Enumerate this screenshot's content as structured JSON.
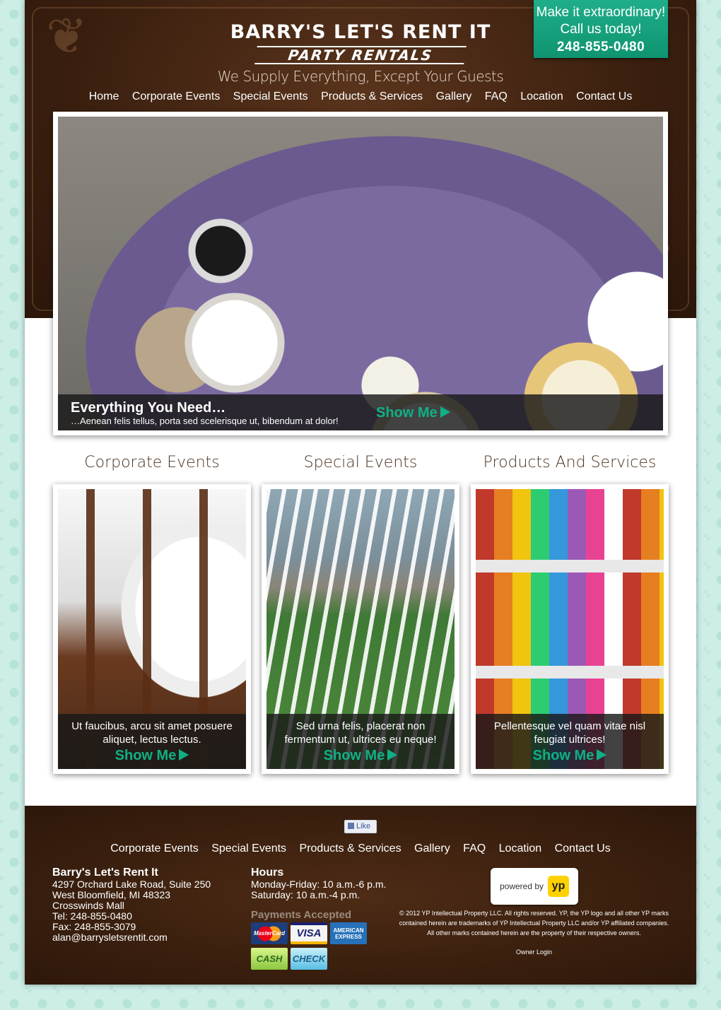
{
  "header": {
    "logo_line1": "BARRY'S LET'S RENT IT",
    "logo_line2": "PARTY RENTALS",
    "tagline": "We Supply Everything, Except Your Guests",
    "callout": {
      "line1": "Make it extraordinary!",
      "line2": "Call us today!",
      "phone": "248-855-0480"
    },
    "nav": [
      "Home",
      "Corporate Events",
      "Special Events",
      "Products & Services",
      "Gallery",
      "FAQ",
      "Location",
      "Contact Us"
    ]
  },
  "hero": {
    "title": "Everything You Need…",
    "subtitle": "…Aenean felis tellus, porta sed scelerisque ut, bibendum at dolor!",
    "button": "Show Me"
  },
  "sections": [
    {
      "title": "Corporate Events",
      "text": "Ut faucibus, arcu sit amet posuere aliquet, lectus lectus.",
      "button": "Show Me"
    },
    {
      "title": "Special Events",
      "text": "Sed urna felis, placerat non fermentum ut, ultrices eu neque!",
      "button": "Show Me"
    },
    {
      "title": "Products And Services",
      "text": "Pellentesque vel quam vitae nisl feugiat ultrices!",
      "button": "Show Me"
    }
  ],
  "footer": {
    "like": "Like",
    "nav": [
      "Corporate Events",
      "Special Events",
      "Products & Services",
      "Gallery",
      "FAQ",
      "Location",
      "Contact Us"
    ],
    "address": {
      "name": "Barry's Let's Rent It",
      "line1": "4297 Orchard Lake Road, Suite 250",
      "line2": "West Bloomfield, MI  48323",
      "line3": "Crosswinds Mall",
      "tel": "Tel:   248-855-0480",
      "fax": "Fax:  248-855-3079",
      "email": "alan@barrysletsrentit.com"
    },
    "hours": {
      "title": "Hours",
      "weekday": "Monday-Friday: 10 a.m.-6 p.m.",
      "saturday": "Saturday: 10 a.m.-4 p.m."
    },
    "payments": {
      "label": "Payments Accepted",
      "mastercard": "MasterCard",
      "visa": "VISA",
      "amex": "AMERICAN EXPRESS",
      "cash": "CASH",
      "check": "CHECK"
    },
    "yp": {
      "powered_by": "powered by",
      "logo": "yp"
    },
    "copyright": "© 2012  YP Intellectual Property LLC. All rights reserved. YP, the YP logo and all other YP marks contained herein are trademarks of YP Intellectual Property LLC and/or YP affiliated companies. All other marks contained herein are the property of their respective owners.",
    "owner_login": "Owner Login"
  },
  "colors": {
    "header_brown": "#3a1f0f",
    "accent_green": "#0fb085",
    "callout_green": "#1fae8a",
    "page_bg": "#cdeee6"
  }
}
